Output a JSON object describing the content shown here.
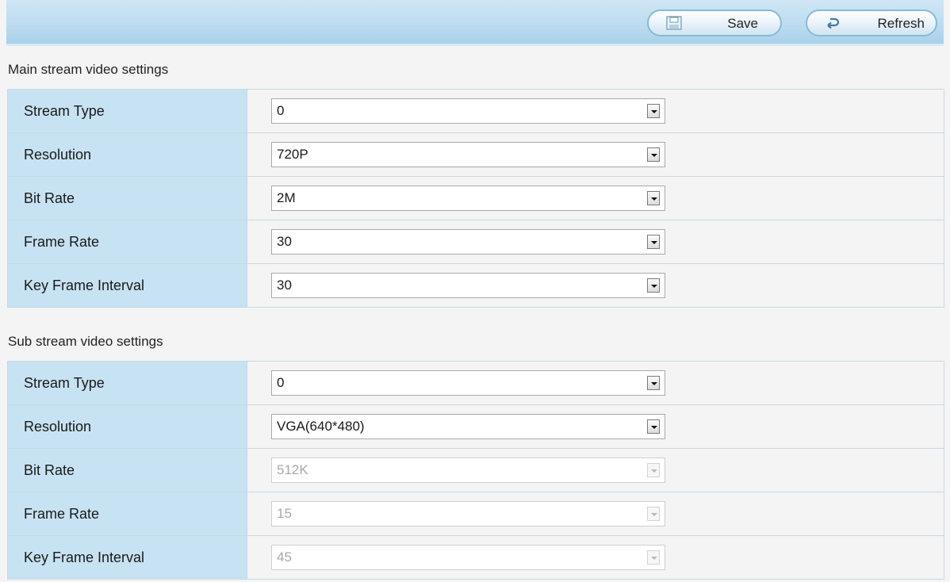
{
  "toolbar": {
    "save_label": "Save",
    "refresh_label": "Refresh",
    "save_icon": "floppy-disk-icon",
    "refresh_icon": "undo-arrow-icon"
  },
  "main_stream": {
    "title": "Main stream video settings",
    "rows": [
      {
        "label": "Stream Type",
        "value": "0",
        "enabled": true
      },
      {
        "label": "Resolution",
        "value": "720P",
        "enabled": true
      },
      {
        "label": "Bit Rate",
        "value": "2M",
        "enabled": true
      },
      {
        "label": "Frame Rate",
        "value": "30",
        "enabled": true
      },
      {
        "label": "Key Frame Interval",
        "value": "30",
        "enabled": true
      }
    ]
  },
  "sub_stream": {
    "title": "Sub stream video settings",
    "rows": [
      {
        "label": "Stream Type",
        "value": "0",
        "enabled": true
      },
      {
        "label": "Resolution",
        "value": "VGA(640*480)",
        "enabled": true
      },
      {
        "label": "Bit Rate",
        "value": "512K",
        "enabled": false
      },
      {
        "label": "Frame Rate",
        "value": "15",
        "enabled": false
      },
      {
        "label": "Key Frame Interval",
        "value": "45",
        "enabled": false
      }
    ]
  },
  "colors": {
    "toolbar_bg": "#bddcf0",
    "label_cell_bg": "#c7e2f3",
    "page_bg": "#f4f4f4",
    "disabled_text": "#a8a8a8"
  }
}
